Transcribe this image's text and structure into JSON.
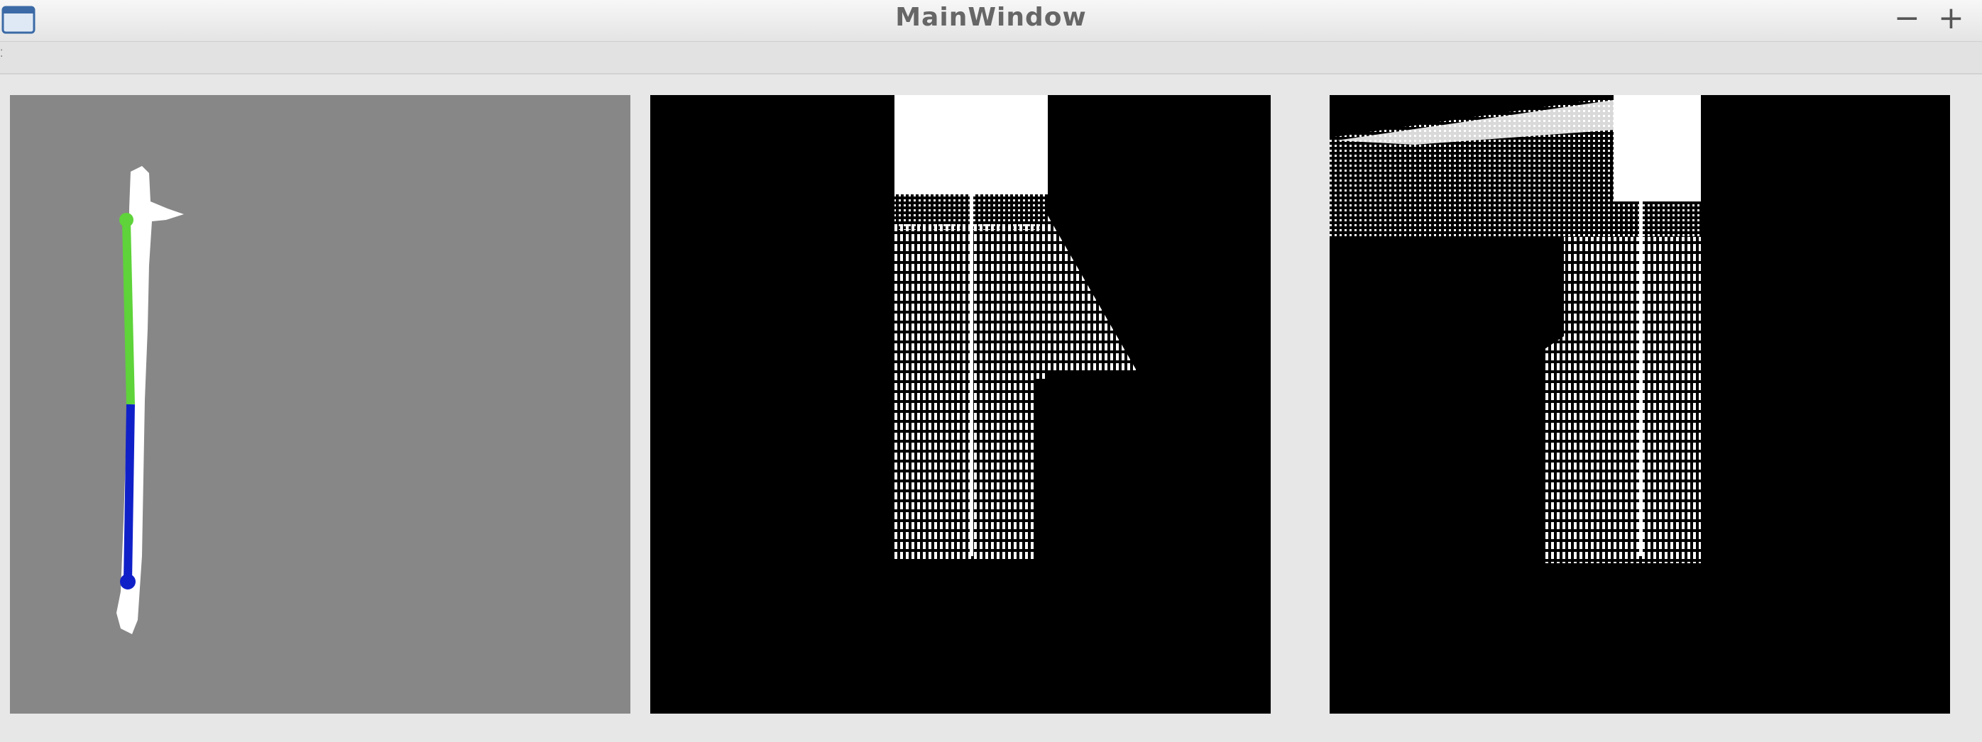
{
  "window": {
    "title": "MainWindow"
  },
  "controls": {
    "minimize": "−",
    "maximize": "+"
  },
  "panels": [
    {
      "name": "tracking-view"
    },
    {
      "name": "binary-scan-view-1"
    },
    {
      "name": "binary-scan-view-2"
    }
  ],
  "colors": {
    "background": "#e7e7e7",
    "panel_gray": "#878787",
    "segment_top": "#5ed33a",
    "segment_bottom": "#1020c8"
  }
}
